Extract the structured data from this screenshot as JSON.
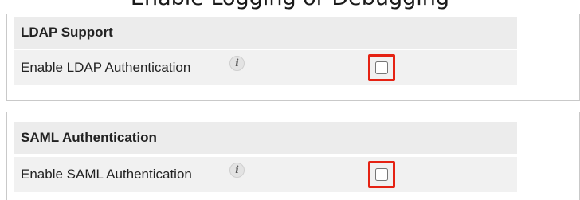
{
  "page": {
    "cut_title": "Enable Logging or Debugging"
  },
  "ldap": {
    "heading": "LDAP Support",
    "label": "Enable LDAP Authentication",
    "info_icon": "info-icon",
    "checked": false,
    "highlight_color": "#e52213"
  },
  "saml": {
    "heading": "SAML Authentication",
    "label": "Enable SAML Authentication",
    "info_icon": "info-icon",
    "checked": false,
    "highlight_color": "#e52213"
  }
}
